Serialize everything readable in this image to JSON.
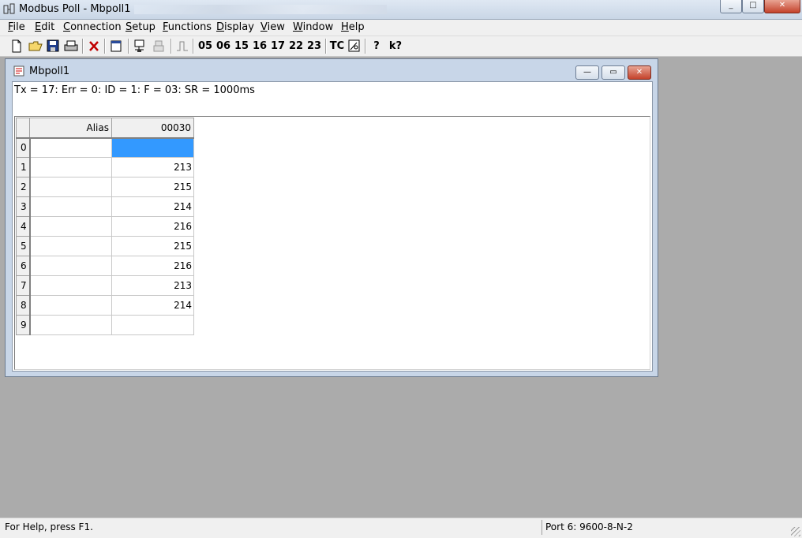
{
  "window": {
    "title": "Modbus Poll - Mbpoll1",
    "minimize": "_",
    "maximize": "□",
    "close": "✕"
  },
  "menu": [
    {
      "label": "File",
      "accel": "F",
      "rest": "ile"
    },
    {
      "label": "Edit",
      "accel": "E",
      "rest": "dit"
    },
    {
      "label": "Connection",
      "accel": "C",
      "rest": "onnection"
    },
    {
      "label": "Setup",
      "accel": "S",
      "rest": "etup"
    },
    {
      "label": "Functions",
      "accel": "F",
      "rest": "unctions"
    },
    {
      "label": "Display",
      "accel": "D",
      "rest": "isplay"
    },
    {
      "label": "View",
      "accel": "V",
      "rest": "iew"
    },
    {
      "label": "Window",
      "accel": "W",
      "rest": "indow"
    },
    {
      "label": "Help",
      "accel": "H",
      "rest": "elp"
    }
  ],
  "toolbar": {
    "fc05": "05",
    "fc06": "06",
    "fc15": "15",
    "fc16": "16",
    "fc17": "17",
    "fc22": "22",
    "fc23": "23",
    "tc": "TC",
    "help": "?",
    "context_help": "k?"
  },
  "child": {
    "title": "Mbpoll1",
    "status": "Tx = 17: Err = 0: ID = 1: F = 03: SR = 1000ms",
    "columns": {
      "alias": "Alias",
      "address": "00030"
    },
    "rows": [
      {
        "index": "0",
        "alias": "",
        "value": ""
      },
      {
        "index": "1",
        "alias": "",
        "value": "213"
      },
      {
        "index": "2",
        "alias": "",
        "value": "215"
      },
      {
        "index": "3",
        "alias": "",
        "value": "214"
      },
      {
        "index": "4",
        "alias": "",
        "value": "216"
      },
      {
        "index": "5",
        "alias": "",
        "value": "215"
      },
      {
        "index": "6",
        "alias": "",
        "value": "216"
      },
      {
        "index": "7",
        "alias": "",
        "value": "213"
      },
      {
        "index": "8",
        "alias": "",
        "value": "214"
      },
      {
        "index": "9",
        "alias": "",
        "value": ""
      }
    ],
    "selected_row": 0
  },
  "statusbar": {
    "help": "For Help, press F1.",
    "port": "Port 6: 9600-8-N-2"
  },
  "colors": {
    "selection": "#3399ff",
    "workspace": "#ababab"
  }
}
